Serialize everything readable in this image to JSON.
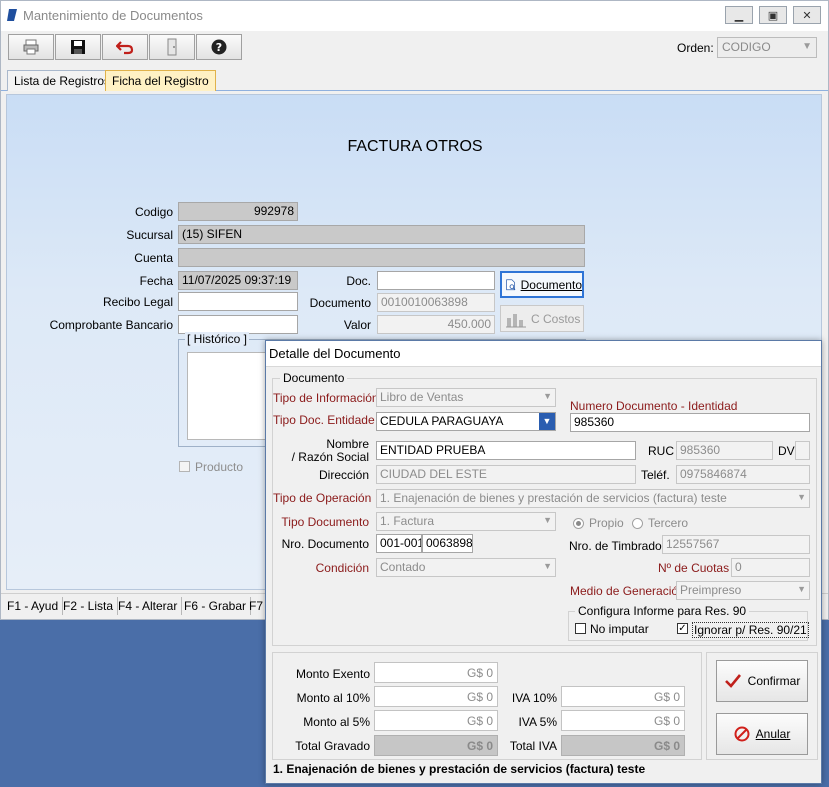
{
  "window": {
    "title": "Mantenimiento de Documentos"
  },
  "toolbar": {
    "orden_label": "Orden:",
    "orden_value": "CODIGO"
  },
  "tabs": {
    "lista": "Lista de Registros",
    "ficha": "Ficha del Registro"
  },
  "form": {
    "title": "FACTURA OTROS",
    "codigo_label": "Codigo",
    "codigo_value": "992978",
    "sucursal_label": "Sucursal",
    "sucursal_value": "(15) SIFEN",
    "cuenta_label": "Cuenta",
    "cuenta_value": "",
    "fecha_label": "Fecha",
    "fecha_value": "11/07/2025 09:37:19",
    "recibo_label": "Recibo Legal",
    "recibo_value": "",
    "comprobante_label": "Comprobante Bancario",
    "comprobante_value": "",
    "doc_label": "Doc.",
    "doc_value": "",
    "documento_label": "Documento",
    "documento_value": "0010010063898",
    "valor_label": "Valor",
    "valor_value": "450.000",
    "documento_button": "Documento",
    "costos_button": "C Costos",
    "historico_label": "[ Histórico ]",
    "producto_label": "Producto"
  },
  "fkeys": [
    "F1 - Ayud",
    "F2 - Lista",
    "F4 - Alterar",
    "F6 - Grabar",
    "F7 -"
  ],
  "dialog": {
    "title": "Detalle del Documento",
    "group_label": "Documento",
    "tipo_info_label": "Tipo de Información",
    "tipo_info_value": "Libro de Ventas",
    "tipo_doc_ent_label": "Tipo Doc. Entidade",
    "tipo_doc_ent_value": "CEDULA PARAGUAYA",
    "num_doc_label": "Numero Documento - Identidad",
    "num_doc_value": "985360",
    "nombre_label_1": "Nombre",
    "nombre_label_2": "/ Razón Social",
    "nombre_value": "ENTIDAD PRUEBA",
    "ruc_label": "RUC",
    "ruc_value": "985360",
    "dv_label": "DV",
    "dv_value": "",
    "direccion_label": "Dirección",
    "direccion_value": "CIUDAD DEL ESTE",
    "telef_label": "Teléf.",
    "telef_value": "0975846874",
    "tipo_op_label": "Tipo de Operación",
    "tipo_op_value": "1. Enajenación de bienes y prestación de servicios (factura) teste",
    "tipo_documento_label": "Tipo Documento",
    "tipo_documento_value": "1. Factura",
    "propio_label": "Propio",
    "tercero_label": "Tercero",
    "nro_doc_label": "Nro. Documento",
    "nro_doc_prefix": "001-001",
    "nro_doc_number": "0063898",
    "nro_timbrado_label": "Nro. de Timbrado",
    "nro_timbrado_value": "12557567",
    "cuotas_label": "Nº de Cuotas",
    "cuotas_value": "0",
    "condicion_label": "Condición",
    "condicion_value": "Contado",
    "medio_label": "Medio de Generación",
    "medio_value": "Preimpreso",
    "res90_label": "Configura Informe para Res. 90",
    "no_imputar_label": "No imputar",
    "ignorar_label": "Ignorar p/ Res. 90/21",
    "monto_exento_label": "Monto Exento",
    "monto_exento_value": "G$ 0",
    "monto10_label": "Monto al 10%",
    "monto10_value": "G$ 0",
    "monto5_label": "Monto al 5%",
    "monto5_value": "G$ 0",
    "total_gravado_label": "Total Gravado",
    "total_gravado_value": "G$ 0",
    "iva10_label": "IVA 10%",
    "iva10_value": "G$ 0",
    "iva5_label": "IVA 5%",
    "iva5_value": "G$ 0",
    "total_iva_label": "Total IVA",
    "total_iva_value": "G$ 0",
    "confirmar_button": "Confirmar",
    "anular_button": "Anular",
    "status": "1. Enajenación de bienes y prestación de servicios (factura) teste"
  }
}
